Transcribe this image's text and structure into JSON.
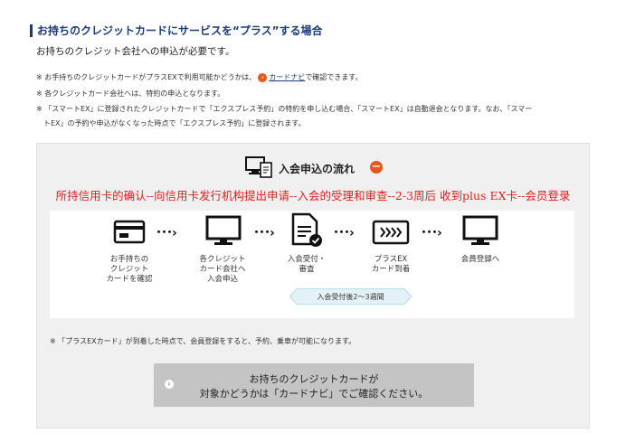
{
  "header": {
    "title": "お持ちのクレジットカードにサービスを“プラス”する場合",
    "subtitle": "お持ちのクレジット会社への申込が必要です。"
  },
  "notes": {
    "n1_pre": "※ お手持ちのクレジットカードがプラスEXで利用可能かどうかは、",
    "n1_link": "カードナビ",
    "n1_post": "で確認できます。",
    "n2": "※ 各クレジットカード会社へは、特約の申込となります。",
    "n3a": "※ 「スマートEX」に登録されたクレジットカードで「エクスプレス予約」の特約を申し込む場合、「スマートEX」は自動退会となります。なお、「スマー",
    "n3b": "トEX」の予約や申込がなくなった時点で「エクスプレス予約」に登録されます。"
  },
  "flow": {
    "title": "入会申込の流れ",
    "toggle": "−",
    "annotation": "所持信用卡的确认--向信用卡发行机构提出申请--入会的受理和审查--2-3周后 收到plus EX卡--会员登录",
    "steps": [
      {
        "line1": "お手持ちの",
        "line2": "クレジット",
        "line3": "カードを確認"
      },
      {
        "line1": "各クレジット",
        "line2": "カード会社へ",
        "line3": "入会申込"
      },
      {
        "line1": "入会受付・",
        "line2": "審査",
        "line3": ""
      },
      {
        "line1": "プラスEX",
        "line2": "カード到着",
        "line3": ""
      },
      {
        "line1": "会員登録へ",
        "line2": "",
        "line3": ""
      }
    ],
    "arrow": "･･･›",
    "duration": "入会受付後2〜3週間",
    "footnote": "※ 「プラスEXカード」が到着した時点で、会員登録をすると、予約、乗車が可能になります。"
  },
  "button": {
    "line1": "お持ちのクレジットカードが",
    "line2": "対象かどうかは「カードナビ」でご確認ください。",
    "arrow": "›"
  },
  "colors": {
    "accent": "#e8561a",
    "navy": "#1a3a7a",
    "annotation": "#e02020"
  }
}
